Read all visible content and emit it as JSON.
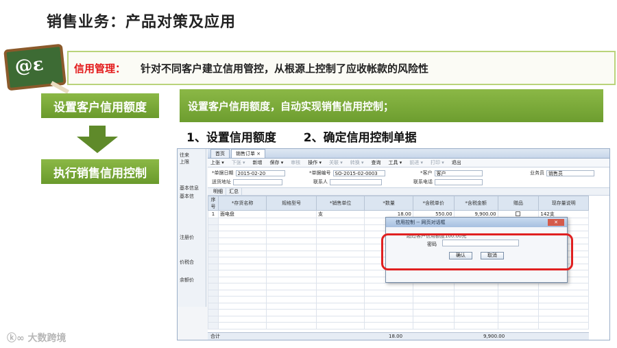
{
  "slide": {
    "title": "销售业务：产品对策及应用",
    "banner_highlight": "信用管理：",
    "banner_text": "针对不同客户建立信用管控，从根源上控制了应收帐款的风险性",
    "left_box_1": "设置客户信用额度",
    "left_box_2": "执行销售信用控制",
    "green_bar": "设置客户信用额度，自动实现销售信用控制；",
    "step_1": "1、设置信用额度",
    "step_2": "2、确定信用控制单据",
    "watermark": "大数跨境"
  },
  "erp": {
    "side_labels": [
      "往来",
      "上限",
      "基本信息",
      "基本信",
      "注册价",
      "价税合",
      "余额价"
    ],
    "tabs": [
      "首页",
      "销售订单 ×"
    ],
    "toolbar": [
      "上张 ▾",
      "下张 ▾",
      "新增",
      "保存 ▾",
      "审核",
      "操作 ▾",
      "关联 ▾",
      "转换 ▾",
      "查询",
      "工具 ▾",
      "前进 ▾",
      "打印 ▾",
      "退出"
    ],
    "toolbar_dim": [
      false,
      true,
      false,
      false,
      true,
      false,
      true,
      true,
      false,
      false,
      true,
      true,
      false
    ],
    "form": {
      "date_label": "*单据日期",
      "date_value": "2015-02-20",
      "no_label": "*单据编号",
      "no_value": "SO-2015-02-0003",
      "customer_label": "*客户",
      "customer_value": "客户",
      "salesman_label": "业务员",
      "salesman_value": "销售员",
      "addr_label": "送货地址",
      "contact_label": "联系人",
      "phone_label": "联系电话"
    },
    "subtabs": [
      "明细",
      "汇总"
    ],
    "columns": [
      "序号",
      "*存货名称",
      "规格型号",
      "*销售单位",
      "*数量",
      "*含税单价",
      "*含税金额",
      "赠品",
      "现存量说明"
    ],
    "rows": [
      [
        "1",
        "面电盘",
        "",
        "支",
        "18.00",
        "550.00",
        "9,900.00",
        "",
        "142支"
      ]
    ],
    "footer_label": "合计",
    "footer_qty": "18.00",
    "footer_amount": "9,900.00"
  },
  "dialog": {
    "title": "信用控制 -- 网页对话框",
    "message": "超过客户信用额度100.00元",
    "password_label": "密码",
    "ok": "确认",
    "cancel": "取消"
  },
  "colors": {
    "accent_green": "#7aa83a",
    "highlight_red": "#e3191a"
  }
}
